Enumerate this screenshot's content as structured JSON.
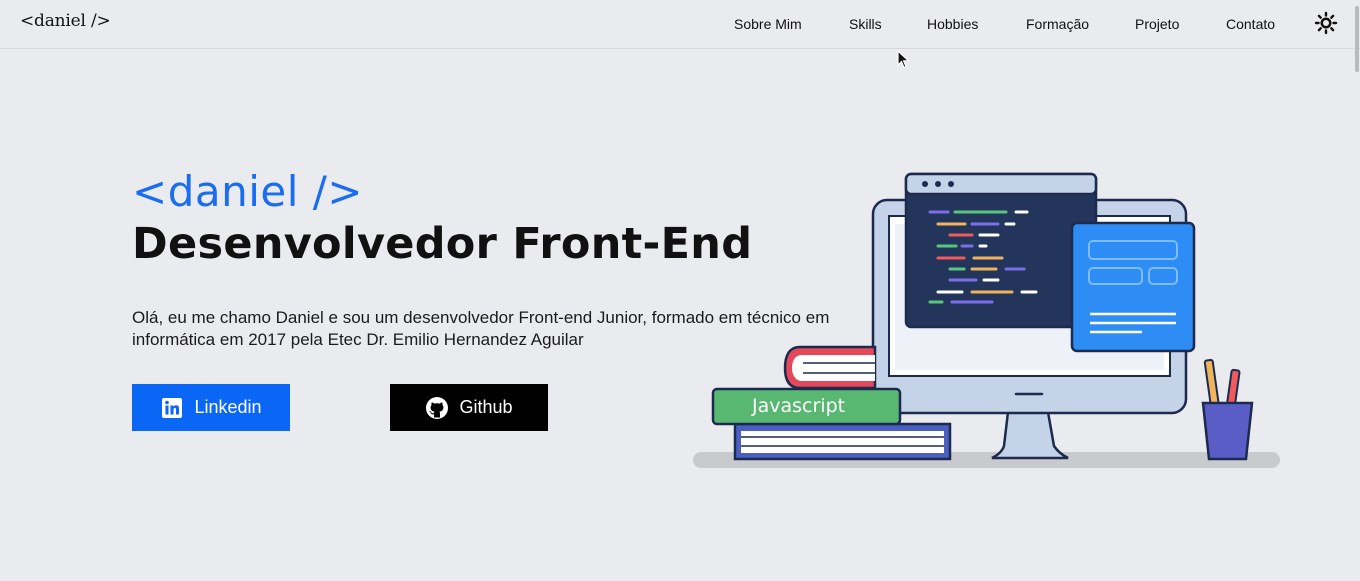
{
  "nav": {
    "logo": "<daniel />",
    "links": [
      "Sobre Mim",
      "Skills",
      "Hobbies",
      "Formação",
      "Projeto",
      "Contato"
    ],
    "theme_icon": "sun-icon"
  },
  "hero": {
    "tag": "<daniel />",
    "title": "Desenvolvedor Front-End",
    "description": "Olá, eu me chamo Daniel e sou um desenvolvedor Front-end Junior, formado em técnico em informática em 2017 pela Etec Dr. Emilio Hernandez Aguilar",
    "linkedin_label": "Linkedin",
    "github_label": "Github"
  },
  "illustration": {
    "book_label": "Javascript"
  },
  "colors": {
    "accent": "#1a6cf0",
    "linkedin": "#0a66f5",
    "github": "#000000",
    "background": "#eaebef"
  }
}
